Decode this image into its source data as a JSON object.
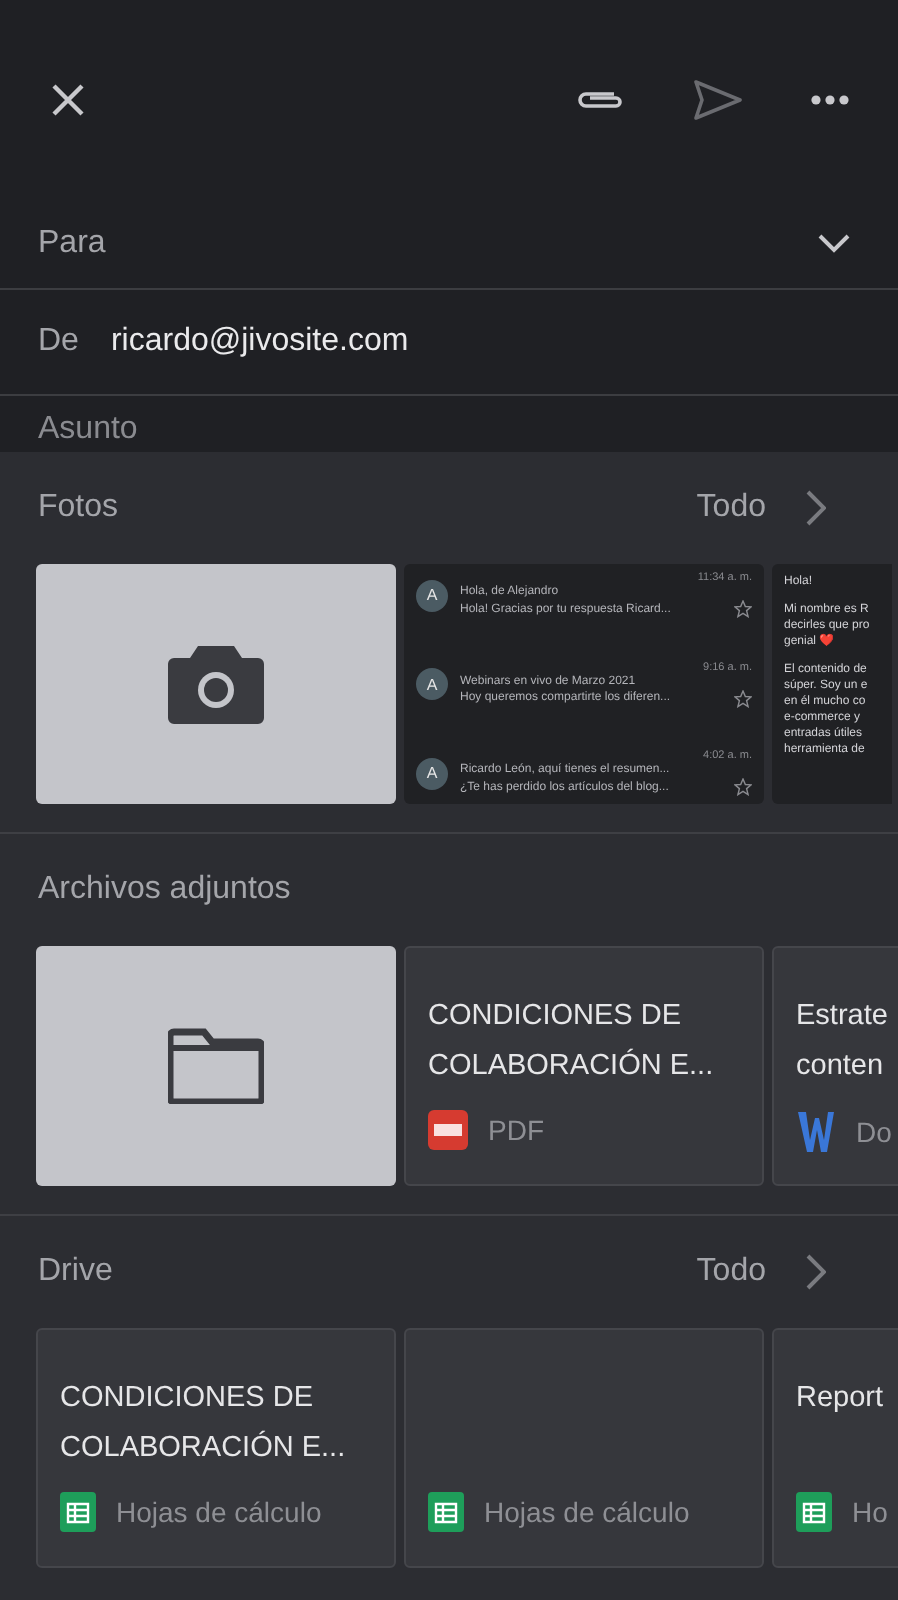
{
  "compose": {
    "to_label": "Para",
    "from_label": "De",
    "from_value": "ricardo@jivosite.com",
    "subject_placeholder": "Asunto"
  },
  "photos": {
    "title": "Fotos",
    "see_all": "Todo",
    "items": [
      {
        "kind": "camera"
      },
      {
        "kind": "inbox",
        "emails": [
          {
            "avatar": "A",
            "time": "11:34 a. m.",
            "subject": "Hola, de Alejandro",
            "preview": "Hola! Gracias por tu respuesta Ricard..."
          },
          {
            "avatar": "A",
            "time": "9:16 a. m.",
            "subject": "Webinars en vivo de Marzo 2021",
            "preview": "Hoy queremos compartirte los diferen..."
          },
          {
            "avatar": "A",
            "time": "4:02 a. m.",
            "subject": "Ricardo León, aquí tienes el resumen...",
            "preview": "¿Te has perdido los artículos del blog..."
          }
        ]
      },
      {
        "kind": "message",
        "paragraphs": [
          [
            "Hola!"
          ],
          [
            "Mi nombre es R",
            "decirles que pro",
            "genial ❤️"
          ],
          [
            "El contenido de",
            "súper. Soy un e",
            "en él mucho co",
            "e-commerce y",
            "entradas útiles",
            "herramienta de"
          ]
        ]
      }
    ]
  },
  "attachments": {
    "title": "Archivos adjuntos",
    "items": [
      {
        "kind": "folder"
      },
      {
        "kind": "pdf",
        "title_lines": [
          "CONDICIONES DE",
          "COLABORACIÓN E..."
        ],
        "type_label": "PDF"
      },
      {
        "kind": "doc",
        "title_lines": [
          "Estrate",
          "conten"
        ],
        "type_label": "Do"
      }
    ]
  },
  "drive": {
    "title": "Drive",
    "see_all": "Todo",
    "items": [
      {
        "kind": "sheet",
        "title_lines": [
          "CONDICIONES DE",
          "COLABORACIÓN E..."
        ],
        "type_label": "Hojas de cálculo"
      },
      {
        "kind": "sheet",
        "type_label": "Hojas de cálculo"
      },
      {
        "kind": "sheet",
        "title_lines": [
          "Report"
        ],
        "type_label": "Ho"
      }
    ]
  }
}
